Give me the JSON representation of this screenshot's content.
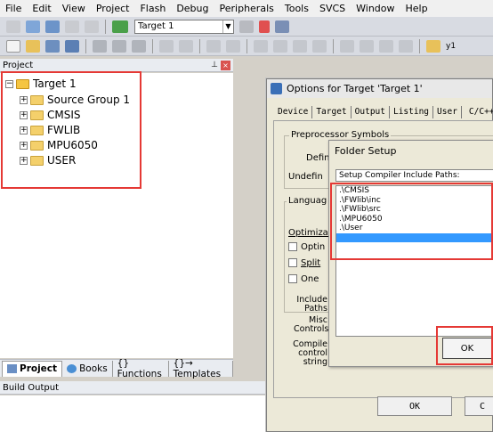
{
  "menu": [
    "File",
    "Edit",
    "View",
    "Project",
    "Flash",
    "Debug",
    "Peripherals",
    "Tools",
    "SVCS",
    "Window",
    "Help"
  ],
  "toolbar": {
    "target": "Target 1",
    "find_text": "y1"
  },
  "project": {
    "title": "Project",
    "root": "Target 1",
    "groups": [
      "Source Group 1",
      "CMSIS",
      "FWLIB",
      "MPU6050",
      "USER"
    ],
    "tabs": [
      "Project",
      "Books",
      "{} Functions",
      "{}→ Templates"
    ]
  },
  "build_output": {
    "title": "Build Output"
  },
  "options_dialog": {
    "title": "Options for Target 'Target 1'",
    "tabs": [
      "Device",
      "Target",
      "Output",
      "Listing",
      "User",
      "C/C++"
    ],
    "preprocessor_label": "Preprocessor Symbols",
    "define_label": "Defin",
    "undefine_label": "Undefin",
    "language_label": "Languag",
    "optimization_label": "Optimizati",
    "options": [
      "Optin",
      "Split",
      "One"
    ],
    "include_label": "Include\nPaths",
    "misc_label": "Misc\nControls",
    "compiler_label": "Compile\ncontrol\nstring",
    "ok_label": "OK",
    "cancel_label": "C"
  },
  "folder_dialog": {
    "title": "Folder Setup",
    "label": "Setup Compiler Include Paths:",
    "paths": [
      ".\\CMSIS",
      ".\\FWlib\\inc",
      ".\\FWlib\\src",
      ".\\MPU6050",
      ".\\User"
    ],
    "ok_label": "OK"
  },
  "colors": {
    "highlight_red": "#e53935",
    "selection_blue": "#3399ff"
  }
}
